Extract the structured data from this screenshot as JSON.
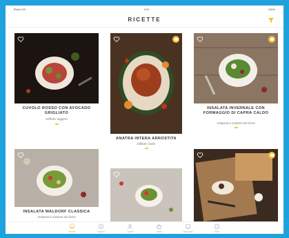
{
  "status": {
    "left": "iPad 2:00",
    "time": "9:41",
    "right": "100%"
  },
  "navbar": {
    "title": "RICETTE"
  },
  "icons": {
    "heart": "heart-outline-icon",
    "badge": "chef-hat-badge-icon",
    "filter": "filter-icon"
  },
  "colors": {
    "frame": "#1ea3dd",
    "accent": "#f4c238",
    "text": "#333333"
  },
  "cards": [
    {
      "id": "cuvolo",
      "title": "CUVOLO ROSSO CON AVOCADO GRIGLIATO",
      "subtitle": "Difficile: leggero",
      "badge": false
    },
    {
      "id": "anatra",
      "title": "ANATRA INTERA ARROSTITA",
      "subtitle": "Difficile: facile",
      "badge": true
    },
    {
      "id": "insalata-invernale",
      "title": "INSALATA INVERNALE CON FORMAGGIO DI CAPRA CALDO",
      "subtitle": "Antipasti e contorni dal forno",
      "badge": true
    },
    {
      "id": "waldorf",
      "title": "INSALATA WALDORF CLASSICA",
      "subtitle": "Antipasti e contorni dal forno",
      "badge": false
    },
    {
      "id": "piatto-5",
      "title": "",
      "subtitle": "",
      "badge": false
    },
    {
      "id": "piatto-6",
      "title": "",
      "subtitle": "",
      "badge": true
    }
  ],
  "tabs": [
    {
      "label": "Ricette",
      "icon": "chef-hat-icon",
      "active": true
    },
    {
      "label": "Esplora",
      "icon": "compass-icon",
      "active": false
    },
    {
      "label": "Cuochi",
      "icon": "person-icon",
      "active": false
    },
    {
      "label": "Cesto",
      "icon": "basket-icon",
      "active": false
    },
    {
      "label": "Dispositivi",
      "icon": "device-icon",
      "active": false
    },
    {
      "label": "Altro",
      "icon": "more-icon",
      "active": false
    }
  ]
}
